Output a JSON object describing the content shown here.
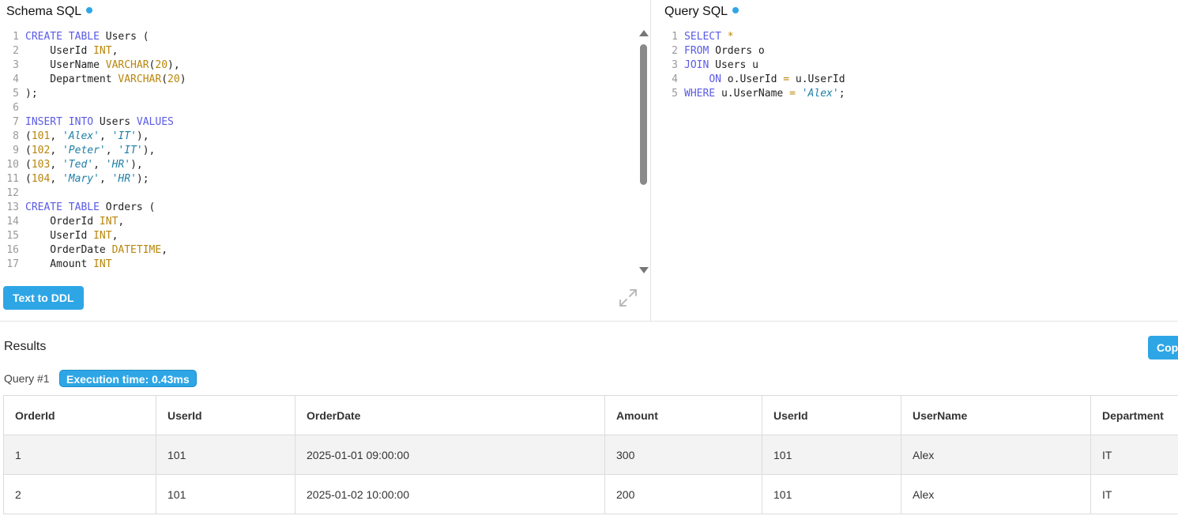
{
  "colors": {
    "accent": "#2ea6e6",
    "status_dot": "#2ea6e6"
  },
  "schema": {
    "title": "Schema SQL",
    "lines": [
      [
        [
          "kw",
          "CREATE"
        ],
        [
          "id",
          " "
        ],
        [
          "kw",
          "TABLE"
        ],
        [
          "id",
          " Users ("
        ]
      ],
      [
        [
          "id",
          "    UserId "
        ],
        [
          "num",
          "INT"
        ],
        [
          "id",
          ","
        ]
      ],
      [
        [
          "id",
          "    UserName "
        ],
        [
          "num",
          "VARCHAR"
        ],
        [
          "id",
          "("
        ],
        [
          "num",
          "20"
        ],
        [
          "id",
          "),"
        ]
      ],
      [
        [
          "id",
          "    Department "
        ],
        [
          "num",
          "VARCHAR"
        ],
        [
          "id",
          "("
        ],
        [
          "num",
          "20"
        ],
        [
          "id",
          ")"
        ]
      ],
      [
        [
          "id",
          ");"
        ]
      ],
      [],
      [
        [
          "kw",
          "INSERT"
        ],
        [
          "id",
          " "
        ],
        [
          "kw",
          "INTO"
        ],
        [
          "id",
          " Users "
        ],
        [
          "kw",
          "VALUES"
        ]
      ],
      [
        [
          "id",
          "("
        ],
        [
          "num",
          "101"
        ],
        [
          "id",
          ", "
        ],
        [
          "str",
          "'Alex'"
        ],
        [
          "id",
          ", "
        ],
        [
          "str",
          "'IT'"
        ],
        [
          "id",
          "),"
        ]
      ],
      [
        [
          "id",
          "("
        ],
        [
          "num",
          "102"
        ],
        [
          "id",
          ", "
        ],
        [
          "str",
          "'Peter'"
        ],
        [
          "id",
          ", "
        ],
        [
          "str",
          "'IT'"
        ],
        [
          "id",
          "),"
        ]
      ],
      [
        [
          "id",
          "("
        ],
        [
          "num",
          "103"
        ],
        [
          "id",
          ", "
        ],
        [
          "str",
          "'Ted'"
        ],
        [
          "id",
          ", "
        ],
        [
          "str",
          "'HR'"
        ],
        [
          "id",
          "),"
        ]
      ],
      [
        [
          "id",
          "("
        ],
        [
          "num",
          "104"
        ],
        [
          "id",
          ", "
        ],
        [
          "str",
          "'Mary'"
        ],
        [
          "id",
          ", "
        ],
        [
          "str",
          "'HR'"
        ],
        [
          "id",
          ");"
        ]
      ],
      [],
      [
        [
          "kw",
          "CREATE"
        ],
        [
          "id",
          " "
        ],
        [
          "kw",
          "TABLE"
        ],
        [
          "id",
          " Orders ("
        ]
      ],
      [
        [
          "id",
          "    OrderId "
        ],
        [
          "num",
          "INT"
        ],
        [
          "id",
          ","
        ]
      ],
      [
        [
          "id",
          "    UserId "
        ],
        [
          "num",
          "INT"
        ],
        [
          "id",
          ","
        ]
      ],
      [
        [
          "id",
          "    OrderDate "
        ],
        [
          "num",
          "DATETIME"
        ],
        [
          "id",
          ","
        ]
      ],
      [
        [
          "id",
          "    Amount "
        ],
        [
          "num",
          "INT"
        ]
      ],
      [
        [
          "id",
          ");"
        ]
      ]
    ],
    "text_to_ddl_button": "Text to DDL"
  },
  "query": {
    "title": "Query SQL",
    "lines": [
      [
        [
          "kw",
          "SELECT"
        ],
        [
          "id",
          " "
        ],
        [
          "op",
          "*"
        ]
      ],
      [
        [
          "kw",
          "FROM"
        ],
        [
          "id",
          " Orders o"
        ]
      ],
      [
        [
          "kw",
          "JOIN"
        ],
        [
          "id",
          " Users u"
        ]
      ],
      [
        [
          "id",
          "    "
        ],
        [
          "kw",
          "ON"
        ],
        [
          "id",
          " o.UserId "
        ],
        [
          "op",
          "="
        ],
        [
          "id",
          " u.UserId"
        ]
      ],
      [
        [
          "kw",
          "WHERE"
        ],
        [
          "id",
          " u.UserName "
        ],
        [
          "op",
          "="
        ],
        [
          "id",
          " "
        ],
        [
          "str",
          "'Alex'"
        ],
        [
          "id",
          ";"
        ]
      ]
    ]
  },
  "results": {
    "title": "Results",
    "copy_button": "Copy",
    "query_label": "Query #1",
    "execution_time": "Execution time: 0.43ms",
    "columns": [
      "OrderId",
      "UserId",
      "OrderDate",
      "Amount",
      "UserId",
      "UserName",
      "Department"
    ],
    "rows": [
      [
        "1",
        "101",
        "2025-01-01 09:00:00",
        "300",
        "101",
        "Alex",
        "IT"
      ],
      [
        "2",
        "101",
        "2025-01-02 10:00:00",
        "200",
        "101",
        "Alex",
        "IT"
      ]
    ]
  }
}
